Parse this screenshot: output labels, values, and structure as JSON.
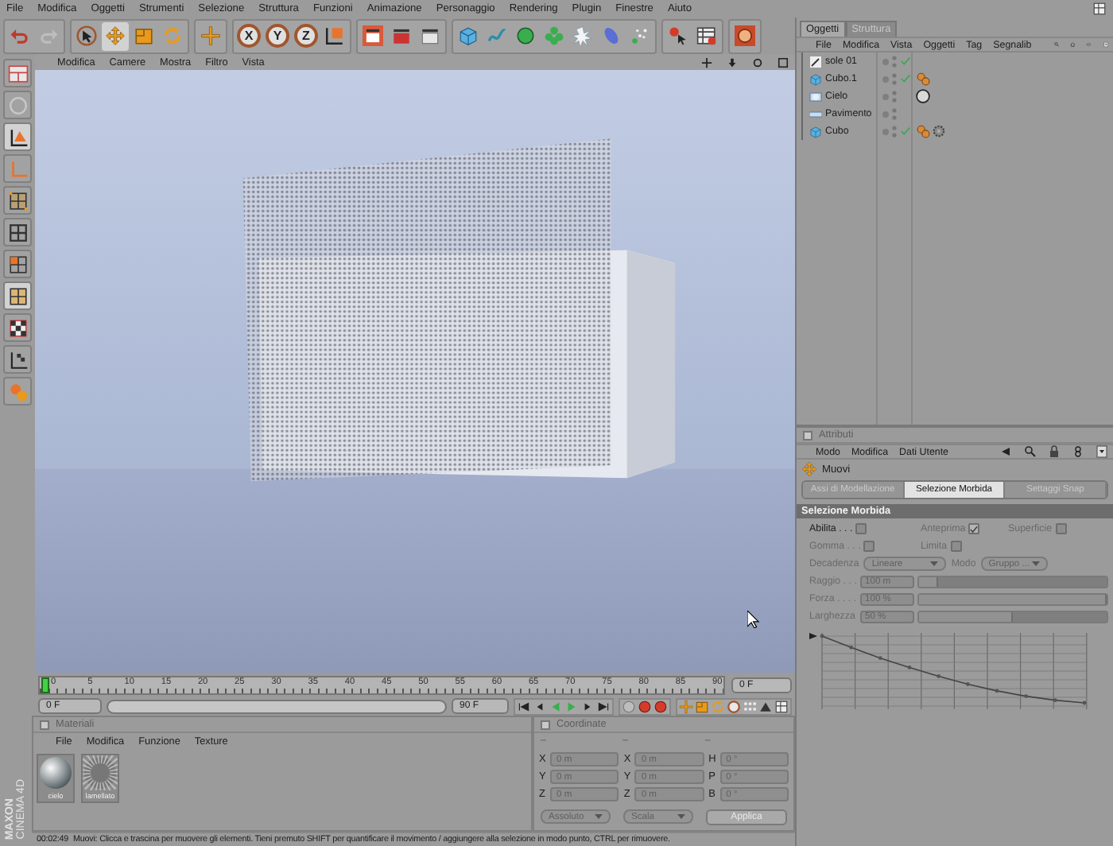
{
  "menu_bar": [
    "File",
    "Modifica",
    "Oggetti",
    "Strumenti",
    "Selezione",
    "Struttura",
    "Funzioni",
    "Animazione",
    "Personaggio",
    "Rendering",
    "Plugin",
    "Finestre",
    "Aiuto"
  ],
  "toolbar": [
    [
      {
        "kind": "undo",
        "selected": false
      },
      {
        "kind": "redo",
        "selected": false
      }
    ],
    [
      {
        "kind": "select",
        "selected": false
      },
      {
        "kind": "move",
        "selected": true
      },
      {
        "kind": "scale",
        "selected": false
      },
      {
        "kind": "rotate",
        "selected": false
      }
    ],
    [
      {
        "kind": "add",
        "selected": false
      }
    ],
    [
      {
        "kind": "lock",
        "label": "X",
        "selected": true
      },
      {
        "kind": "lock",
        "label": "Y",
        "selected": true
      },
      {
        "kind": "lock",
        "label": "Z",
        "selected": true
      },
      {
        "kind": "axis",
        "selected": false
      }
    ],
    [
      {
        "kind": "render-view",
        "selected": false
      },
      {
        "kind": "render-picture",
        "selected": false
      },
      {
        "kind": "render-settings",
        "selected": false
      }
    ],
    [
      {
        "kind": "cube",
        "selected": false
      },
      {
        "kind": "spline",
        "selected": false
      },
      {
        "kind": "nurbs",
        "selected": false
      },
      {
        "kind": "array",
        "selected": false
      },
      {
        "kind": "deformer",
        "selected": false
      },
      {
        "kind": "scene",
        "selected": false
      },
      {
        "kind": "particles",
        "selected": false
      }
    ],
    [
      {
        "kind": "help",
        "selected": false
      },
      {
        "kind": "layout",
        "selected": false
      }
    ],
    [
      {
        "kind": "engine",
        "selected": false
      }
    ]
  ],
  "side_toolbar": [
    {
      "kind": "model",
      "selected": false
    },
    {
      "kind": "texture",
      "selected": false
    },
    {
      "kind": "axis-cone",
      "selected": true
    },
    {
      "kind": "axis-corner",
      "selected": false
    },
    {
      "kind": "points",
      "selected": false
    },
    {
      "kind": "edges",
      "selected": false
    },
    {
      "kind": "polygons",
      "selected": false
    },
    {
      "kind": "uv",
      "selected": true
    },
    {
      "kind": "checker",
      "selected": false
    },
    {
      "kind": "checker-axis",
      "selected": false
    },
    {
      "kind": "tweak",
      "selected": false
    }
  ],
  "viewport": {
    "menu": [
      "Modifica",
      "Camere",
      "Mostra",
      "Filtro",
      "Vista"
    ]
  },
  "timeline": {
    "ticks": [
      "0",
      "5",
      "10",
      "15",
      "20",
      "25",
      "30",
      "35",
      "40",
      "45",
      "50",
      "55",
      "60",
      "65",
      "70",
      "75",
      "80",
      "85",
      "90"
    ],
    "current_frame": "0 F"
  },
  "transport": {
    "start_field": "0 F",
    "range": {
      "level": 1
    },
    "end_field": "90 F"
  },
  "brand": {
    "line1": "MAXON",
    "line2": "CINEMA 4D"
  },
  "materials": {
    "title": "Materiali",
    "menu": [
      "File",
      "Modifica",
      "Funzione",
      "Texture"
    ],
    "items": [
      {
        "name": "cielo",
        "kind": "plain"
      },
      {
        "name": "lamellato",
        "kind": "mesh"
      }
    ]
  },
  "coordinates": {
    "title": "Coordinate",
    "headers": [
      "–",
      "–",
      "–"
    ],
    "rows": [
      [
        {
          "label": "X",
          "value": "0 m"
        },
        {
          "label": "X",
          "value": "0 m"
        },
        {
          "label": "H",
          "value": "0 °"
        }
      ],
      [
        {
          "label": "Y",
          "value": "0 m"
        },
        {
          "label": "Y",
          "value": "0 m"
        },
        {
          "label": "P",
          "value": "0 °"
        }
      ],
      [
        {
          "label": "Z",
          "value": "0 m"
        },
        {
          "label": "Z",
          "value": "0 m"
        },
        {
          "label": "B",
          "value": "0 °"
        }
      ]
    ],
    "dropdowns": [
      "Assoluto",
      "Scala"
    ],
    "apply": "Applica"
  },
  "status_bar": {
    "time": "00:02:49",
    "message": "Muovi: Clicca e trascina per muovere gli elementi. Tieni premuto SHIFT per quantificare il movimento / aggiungere alla selezione in modo punto, CTRL per rimuovere."
  },
  "objects": {
    "tabs": [
      {
        "label": "Oggetti",
        "selected": true
      },
      {
        "label": "Struttura",
        "selected": false
      }
    ],
    "menu": [
      "File",
      "Modifica",
      "Vista",
      "Oggetti",
      "Tag",
      "Segnalib"
    ],
    "rows": [
      {
        "name": "sole 01",
        "kind": "light",
        "enabled": true,
        "tags": []
      },
      {
        "name": "Cubo.1",
        "kind": "cube",
        "enabled": true,
        "tags": [
          {
            "kind": "phong"
          }
        ]
      },
      {
        "name": "Cielo",
        "kind": "sky",
        "enabled": false,
        "tags": [
          {
            "kind": "material"
          }
        ]
      },
      {
        "name": "Pavimento",
        "kind": "floor",
        "enabled": false,
        "tags": []
      },
      {
        "name": "Cubo",
        "kind": "cube",
        "enabled": true,
        "tags": [
          {
            "kind": "phong"
          },
          {
            "kind": "gear"
          }
        ]
      }
    ]
  },
  "attributes": {
    "title": "Attributi",
    "menu": [
      "Modo",
      "Modifica",
      "Dati Utente"
    ],
    "tool": "Muovi",
    "tabs": [
      {
        "label": "Assi di Modellazione",
        "selected": false
      },
      {
        "label": "Selezione Morbida",
        "selected": true
      },
      {
        "label": "Settaggi Snap",
        "selected": false
      }
    ],
    "section": "Selezione Morbida",
    "checks": [
      {
        "label": "Abilita . . .",
        "checked": false,
        "disabled": false
      },
      {
        "label": "Anteprima",
        "checked": true,
        "disabled": true
      },
      {
        "label": "Superficie",
        "checked": false,
        "disabled": true
      },
      {
        "label": "Gomma . . .",
        "checked": false,
        "disabled": true
      },
      {
        "label": "Limita",
        "checked": false,
        "disabled": true
      }
    ],
    "dropdowns": [
      {
        "label": "Decadenza",
        "value": "Lineare"
      },
      {
        "label": "Modo",
        "value": "Gruppo ..."
      }
    ],
    "sliders": [
      {
        "label": "Raggio . . .",
        "value": "100 m",
        "level": 0.1
      },
      {
        "label": "Forza . . . .",
        "value": "100 %",
        "level": 1
      },
      {
        "label": "Larghezza",
        "value": "50 %",
        "level": 0.5
      }
    ]
  }
}
